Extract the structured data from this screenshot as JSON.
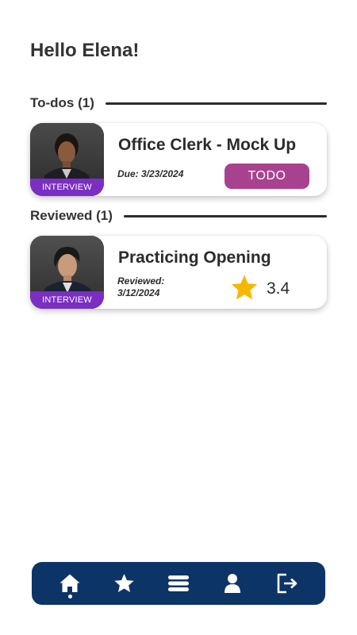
{
  "header": {
    "greeting": "Hello Elena!"
  },
  "todos": {
    "label": "To-dos (1)",
    "items": [
      {
        "title": "Office Clerk - Mock Up",
        "tag": "INTERVIEW",
        "due": "Due: 3/23/2024",
        "button_label": "TODO"
      }
    ]
  },
  "reviewed": {
    "label": "Reviewed (1)",
    "items": [
      {
        "title": "Practicing Opening",
        "tag": "INTERVIEW",
        "reviewed_label": "Reviewed:",
        "reviewed_date": "3/12/2024",
        "rating": "3.4"
      }
    ]
  },
  "nav": {
    "items": [
      "home-icon",
      "star-icon",
      "menu-icon",
      "user-icon",
      "logout-icon"
    ],
    "active": "home"
  },
  "colors": {
    "accent_button": "#a8428f",
    "tag_purple": "#7a2ec2",
    "nav_background": "#0d3466",
    "star": "#f5b800"
  }
}
